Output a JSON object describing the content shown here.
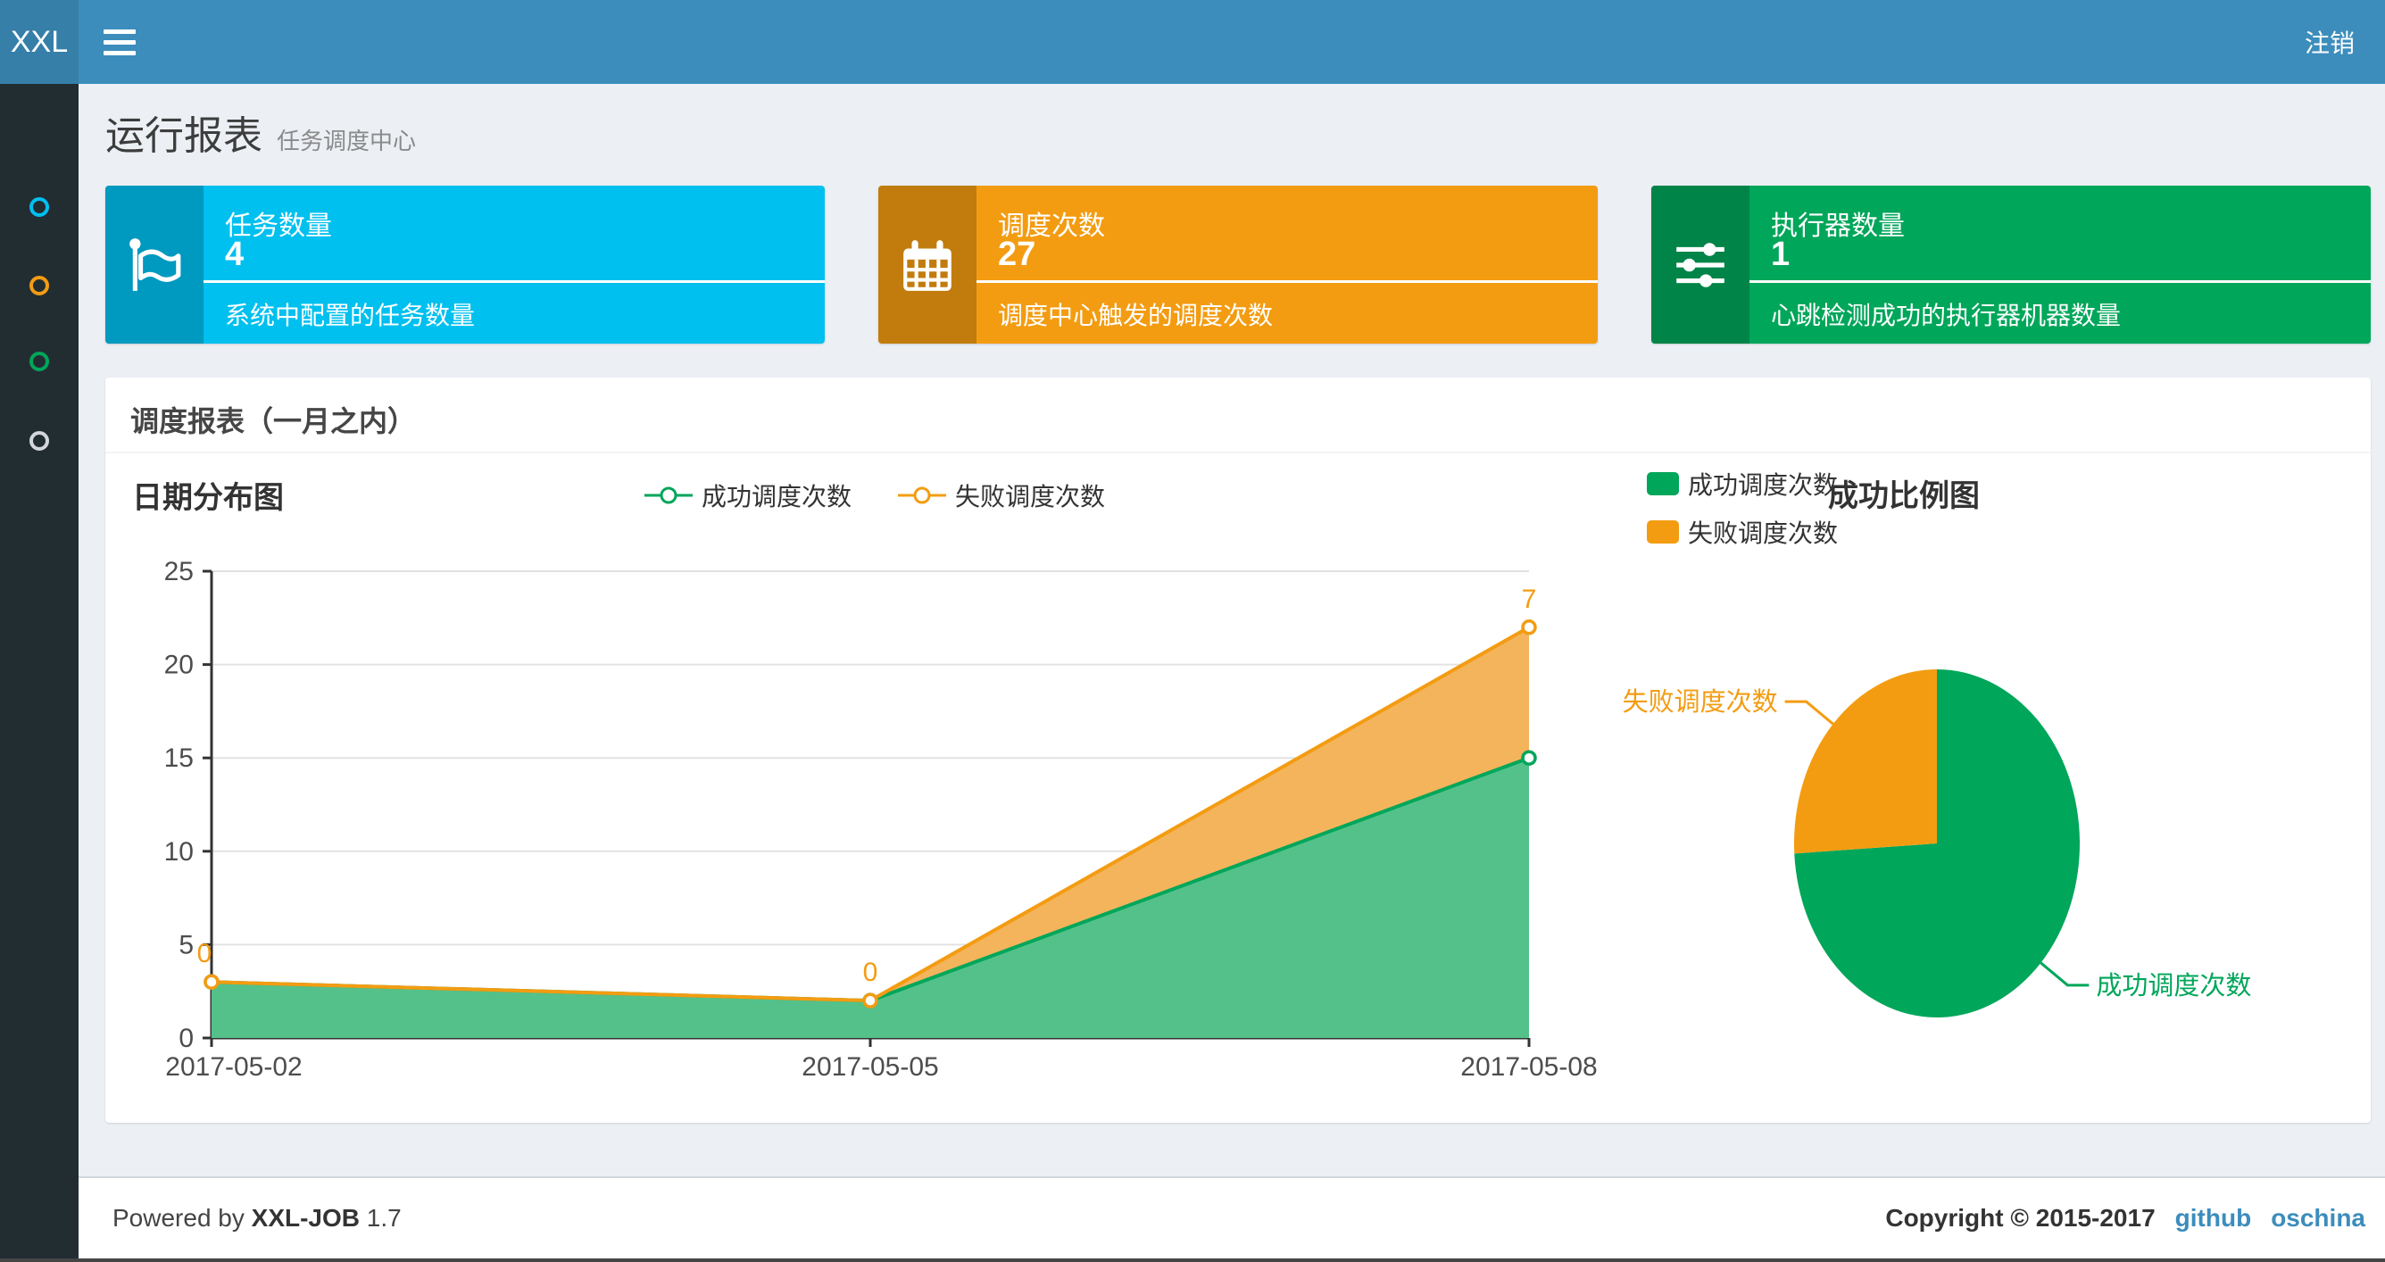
{
  "header": {
    "logo": "XXL",
    "logout": "注销"
  },
  "sidebar": {
    "items": [
      {
        "icon": "circle-icon",
        "color": "#00c0ef"
      },
      {
        "icon": "circle-icon",
        "color": "#f39c12"
      },
      {
        "icon": "circle-icon",
        "color": "#00a65a"
      },
      {
        "icon": "circle-icon",
        "color": "#d2d6de"
      }
    ]
  },
  "page_header": {
    "title": "运行报表",
    "subtitle": "任务调度中心"
  },
  "stat_boxes": [
    {
      "title": "任务数量",
      "value": "4",
      "description": "系统中配置的任务数量",
      "color": "#00c0ef",
      "icon": "flag-icon"
    },
    {
      "title": "调度次数",
      "value": "27",
      "description": "调度中心触发的调度次数",
      "color": "#f39c12",
      "icon": "calendar-icon"
    },
    {
      "title": "执行器数量",
      "value": "1",
      "description": "心跳检测成功的执行器机器数量",
      "color": "#00a65a",
      "icon": "sliders-icon"
    }
  ],
  "panel": {
    "title": "调度报表（一月之内）"
  },
  "chart_data": [
    {
      "type": "area",
      "title": "日期分布图",
      "x": [
        "2017-05-02",
        "2017-05-05",
        "2017-05-08"
      ],
      "series": [
        {
          "name": "成功调度次数",
          "values": [
            3,
            2,
            15
          ],
          "color": "#00a65a"
        },
        {
          "name": "失败调度次数",
          "values": [
            0,
            0,
            7
          ],
          "color": "#f39c12"
        }
      ],
      "stacked": true,
      "point_labels_series": "失败调度次数",
      "point_labels": [
        "0",
        "0",
        "7"
      ],
      "ylim": [
        0,
        25
      ],
      "yticks": [
        0,
        5,
        10,
        15,
        20,
        25
      ],
      "grid": true,
      "legend_position": "top-center"
    },
    {
      "type": "pie",
      "title": "成功比例图",
      "labels": [
        "成功调度次数",
        "失败调度次数"
      ],
      "values": [
        20,
        7
      ],
      "colors": [
        "#00a65a",
        "#f39c12"
      ],
      "legend_position": "top-left"
    }
  ],
  "footer": {
    "powered_by": "Powered by",
    "product": "XXL-JOB",
    "version": "1.7",
    "copyright": "Copyright © 2015-2017",
    "links": [
      "github",
      "oschina"
    ]
  }
}
